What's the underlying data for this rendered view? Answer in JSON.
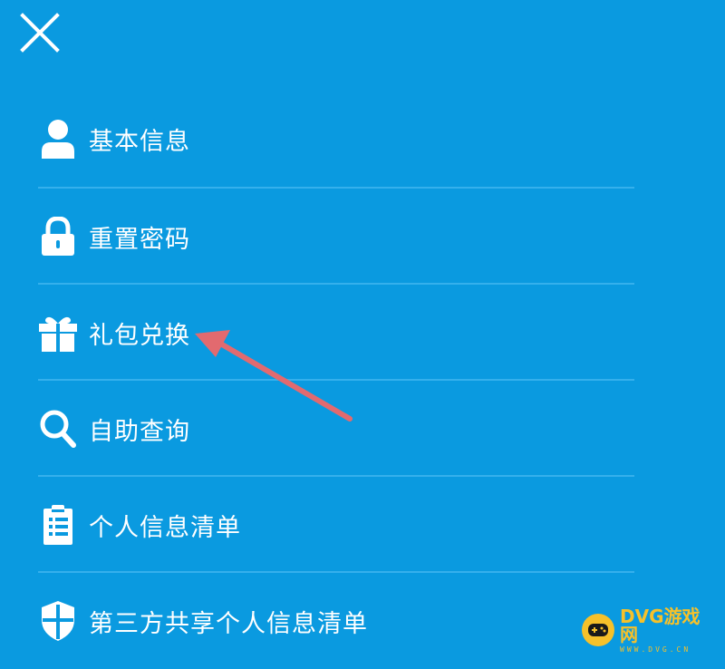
{
  "colors": {
    "background": "#0a9ae0",
    "divider": "#35b0ec",
    "text": "#ffffff",
    "annotation_arrow": "#e26a6f",
    "watermark": "#f6c12a"
  },
  "header": {
    "close_icon": "close-icon"
  },
  "menu": {
    "items": [
      {
        "label": "基本信息",
        "icon": "user-icon"
      },
      {
        "label": "重置密码",
        "icon": "lock-icon"
      },
      {
        "label": "礼包兑换",
        "icon": "gift-icon"
      },
      {
        "label": "自助查询",
        "icon": "search-icon"
      },
      {
        "label": "个人信息清单",
        "icon": "clipboard-icon"
      },
      {
        "label": "第三方共享个人信息清单",
        "icon": "shield-icon"
      }
    ]
  },
  "annotation": {
    "arrow_target": "礼包兑换"
  },
  "watermark": {
    "main": "DVG游戏网",
    "sub": "WWW.DVG.CN"
  }
}
